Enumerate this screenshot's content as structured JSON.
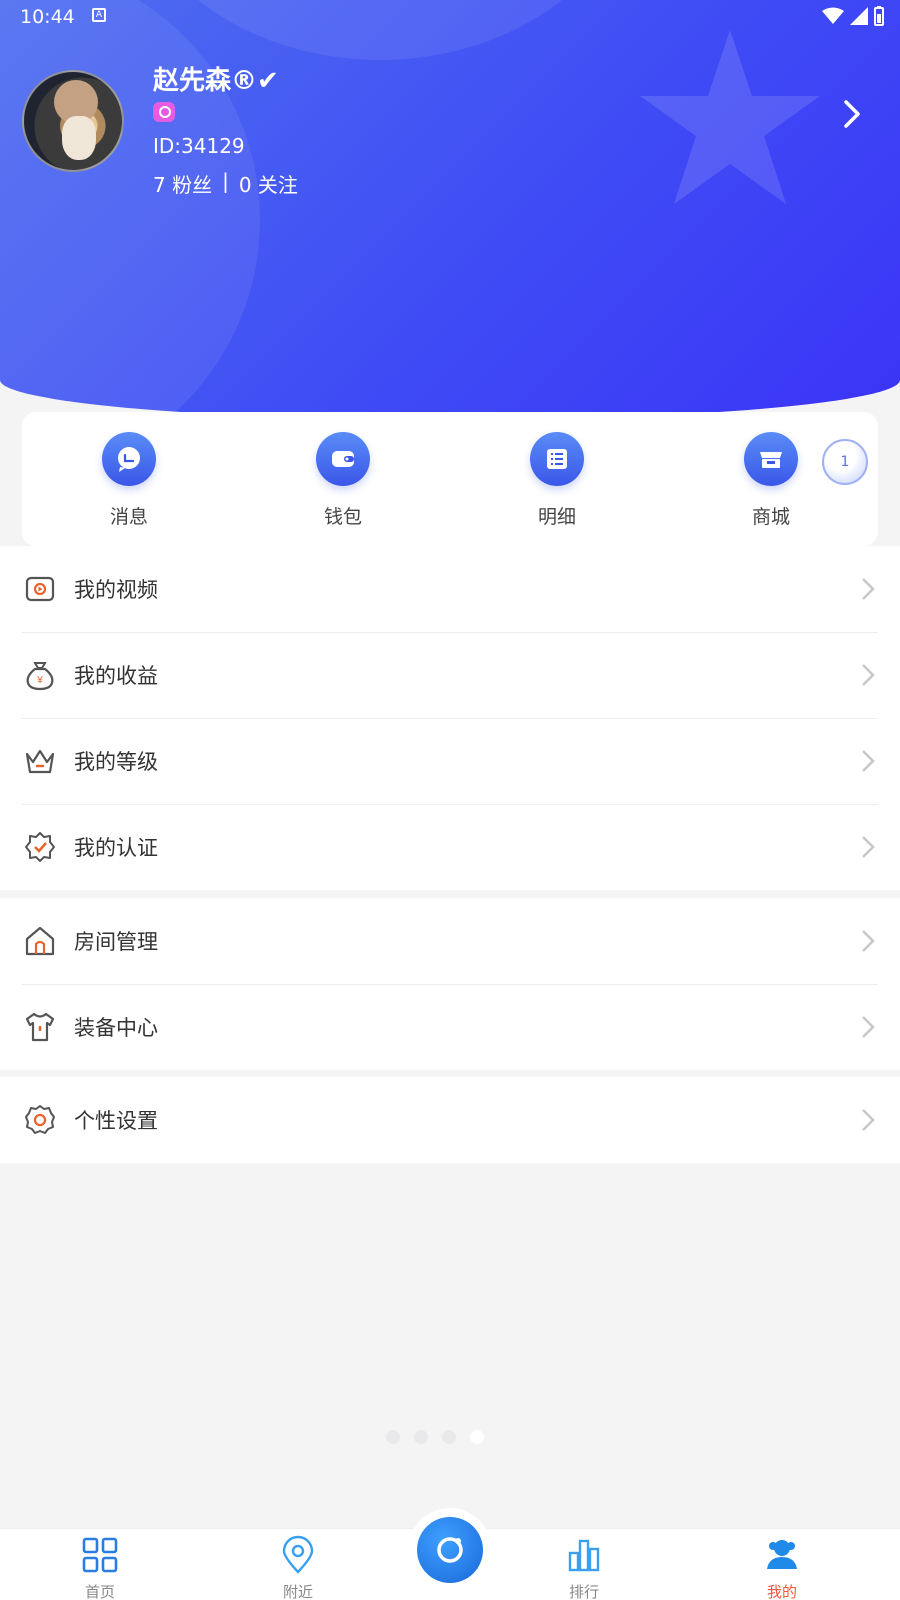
{
  "status_bar": {
    "time": "10:44",
    "a_badge": "A"
  },
  "profile": {
    "name": "赵先森®✔",
    "id_text": "ID:34129",
    "fans": "7 粉丝",
    "separator": "|",
    "following": "0 关注"
  },
  "quick_actions": [
    {
      "label": "消息",
      "icon": "chat-bubble-icon"
    },
    {
      "label": "钱包",
      "icon": "wallet-icon"
    },
    {
      "label": "明细",
      "icon": "list-icon"
    },
    {
      "label": "商城",
      "icon": "store-icon"
    }
  ],
  "floating_badge": "1",
  "menu_group1": [
    {
      "label": "我的视频",
      "icon": "video-icon"
    },
    {
      "label": "我的收益",
      "icon": "money-bag-icon"
    },
    {
      "label": "我的等级",
      "icon": "crown-icon"
    },
    {
      "label": "我的认证",
      "icon": "verified-icon"
    }
  ],
  "menu_group2": [
    {
      "label": "房间管理",
      "icon": "home-icon"
    },
    {
      "label": "装备中心",
      "icon": "shirt-icon"
    }
  ],
  "menu_group3": [
    {
      "label": "个性设置",
      "icon": "gear-icon"
    }
  ],
  "tabs": [
    {
      "label": "首页",
      "icon": "grid-icon"
    },
    {
      "label": "附近",
      "icon": "location-pin-icon"
    },
    {
      "label": "",
      "icon": "camera-icon"
    },
    {
      "label": "排行",
      "icon": "bar-chart-icon"
    },
    {
      "label": "我的",
      "icon": "user-icon",
      "active": true
    }
  ],
  "colors": {
    "accent": "#3f4df5",
    "active_tab": "#f05a3a",
    "icon_orange": "#e8642e"
  }
}
